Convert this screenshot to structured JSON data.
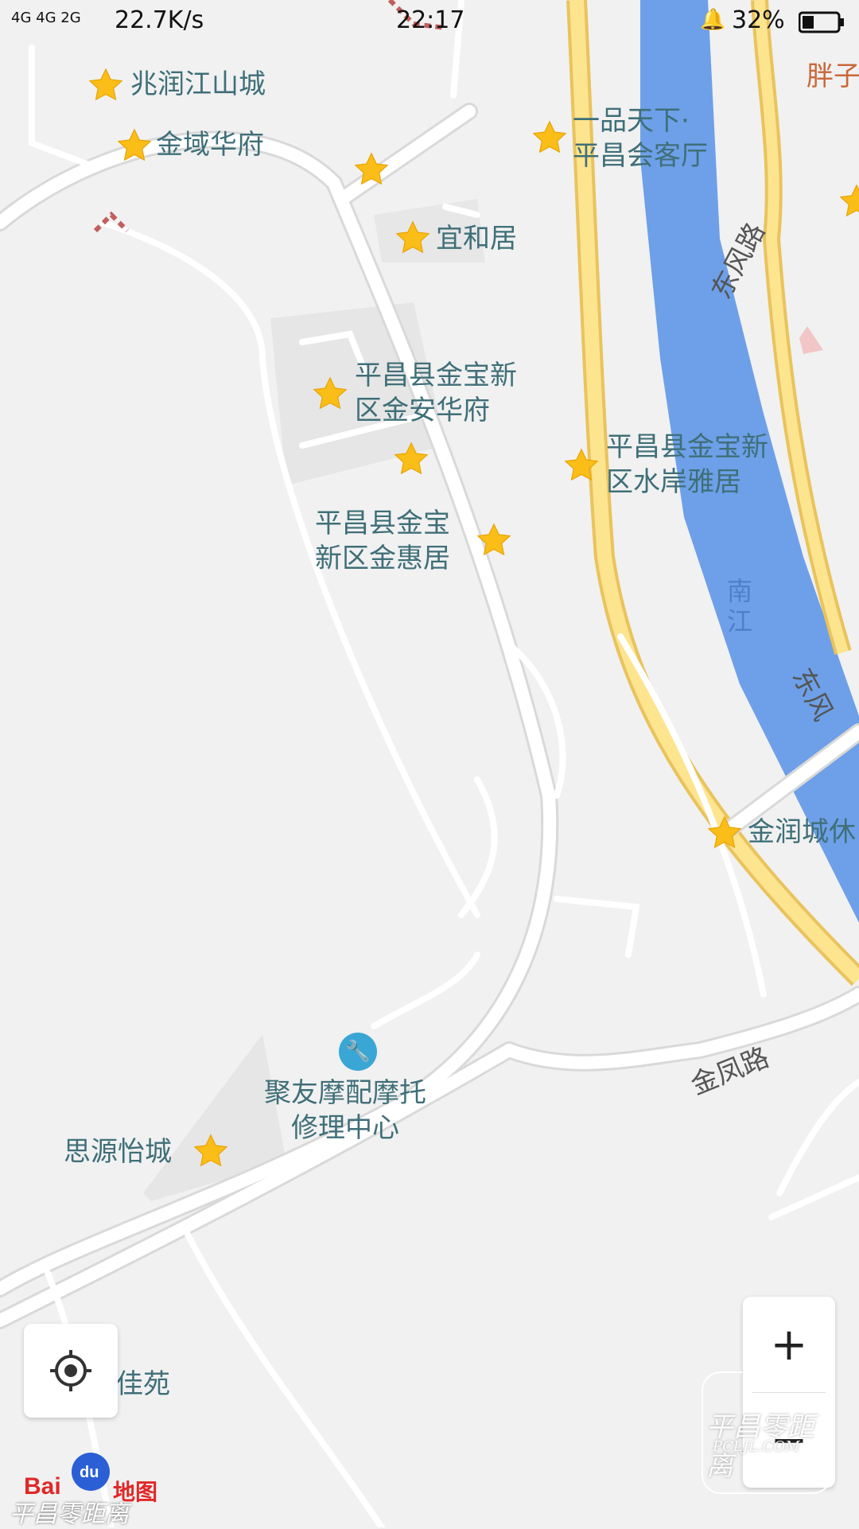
{
  "status_bar": {
    "network": "4G 4G 2G",
    "speed": "22.7K/s",
    "time": "22:17",
    "battery": "32%",
    "icons": [
      "signal-icon",
      "bell-icon",
      "battery-icon"
    ]
  },
  "pois": [
    {
      "name": "兆润江山城"
    },
    {
      "name": "金域华府"
    },
    {
      "name": "宜和居"
    },
    {
      "name": "一品天下·\n平昌会客厅"
    },
    {
      "name": "平昌县金宝新\n区金安华府"
    },
    {
      "name": "平昌县金宝新\n区水岸雅居"
    },
    {
      "name": "平昌县金宝\n新区金惠居"
    },
    {
      "name": "金润城休"
    },
    {
      "name": "聚友摩配摩托\n修理中心"
    },
    {
      "name": "思源怡城"
    },
    {
      "name": "佳苑"
    },
    {
      "name": "胖子"
    }
  ],
  "roads": {
    "dongfeng1": "东风路",
    "dongfeng2": "东风",
    "jinfeng": "金凤路",
    "river": "南江"
  },
  "controls": {
    "zoom_in": "+",
    "zoom_out": "−",
    "locate_icon": "locate-icon"
  },
  "branding": {
    "logo_text": "Bai",
    "logo_text2": "du",
    "logo_text3": "地图",
    "watermark_main": "平昌零距离",
    "watermark_url": "PCLJL.COM",
    "watermark_bottom": "平昌零距离"
  },
  "colors": {
    "river": "#6da0e8",
    "main_road_fill": "#fde48f",
    "main_road_edge": "#e9c35c",
    "road": "#ffffff",
    "poi_star": "#fbbd18",
    "label": "#3f6f78"
  }
}
